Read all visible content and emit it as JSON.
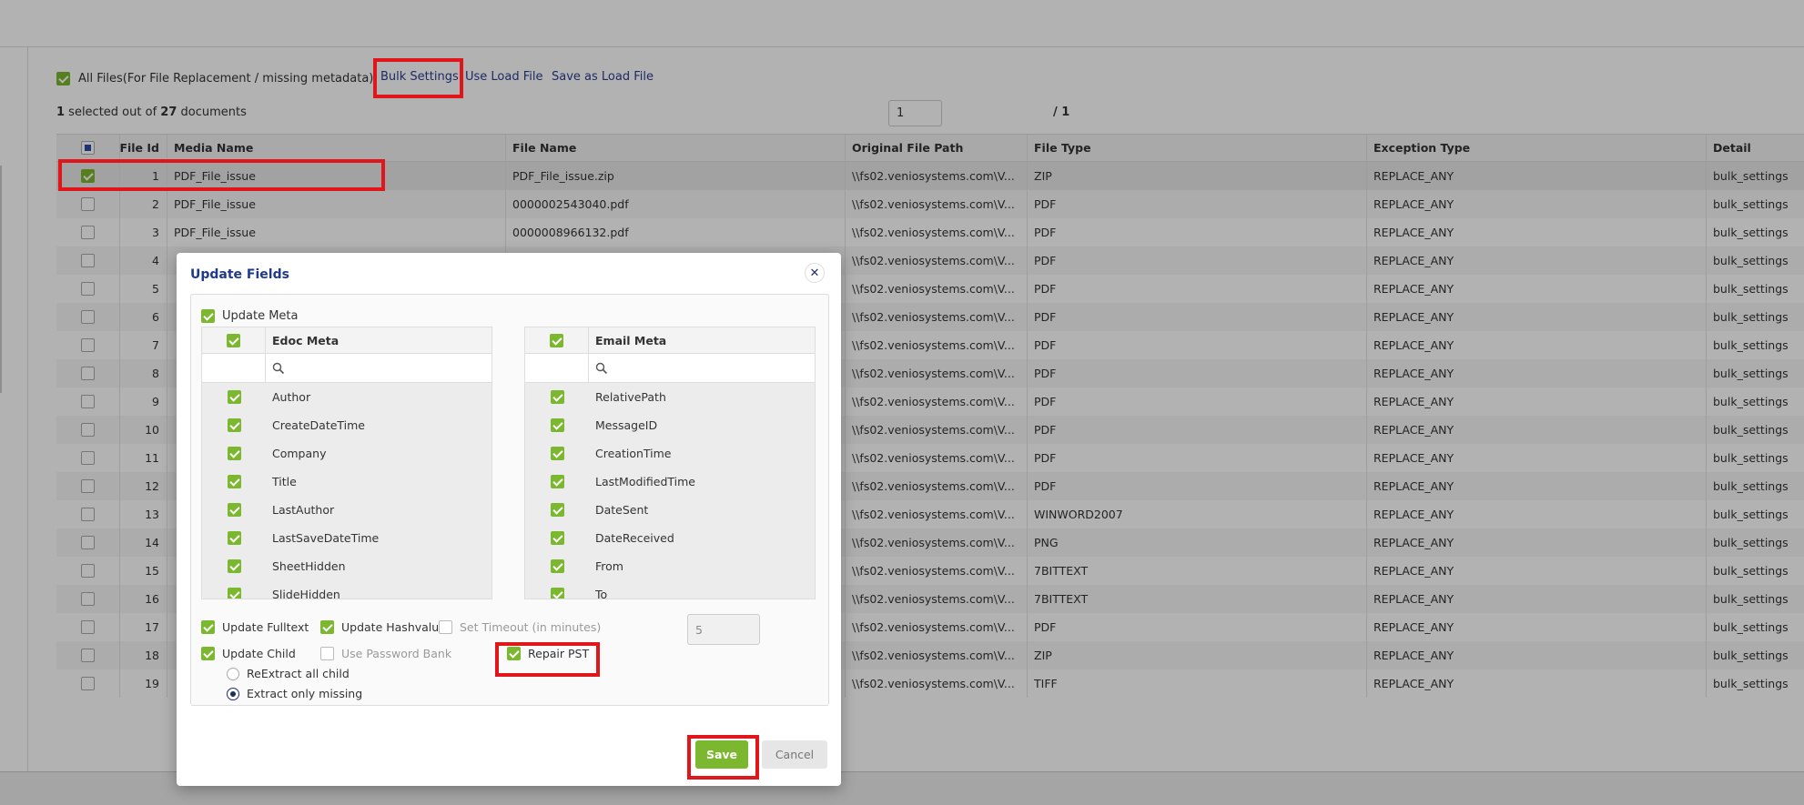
{
  "toolbar": {
    "all_files_label": "All Files(For File Replacement / missing metadata)",
    "bulk_settings": "Bulk Settings",
    "use_load_file": "Use Load File",
    "save_as_load_file": "Save as Load File"
  },
  "selection": {
    "selected": "1",
    "mid": " selected out of ",
    "total": "27",
    "suffix": " documents"
  },
  "pager": {
    "current": "1",
    "total_label": "/ 1"
  },
  "grid": {
    "columns": [
      "File Id",
      "Media Name",
      "File Name",
      "Original File Path",
      "File Type",
      "Exception Type",
      "Detail"
    ],
    "rows": [
      {
        "id": "1",
        "media": "PDF_File_issue",
        "file": "PDF_File_issue.zip",
        "path": "\\\\fs02.veniosystems.com\\V...",
        "type": "ZIP",
        "exc": "REPLACE_ANY",
        "detail": "bulk_settings",
        "checked": true
      },
      {
        "id": "2",
        "media": "PDF_File_issue",
        "file": "0000002543040.pdf",
        "path": "\\\\fs02.veniosystems.com\\V...",
        "type": "PDF",
        "exc": "REPLACE_ANY",
        "detail": "bulk_settings",
        "checked": false
      },
      {
        "id": "3",
        "media": "PDF_File_issue",
        "file": "0000008966132.pdf",
        "path": "\\\\fs02.veniosystems.com\\V...",
        "type": "PDF",
        "exc": "REPLACE_ANY",
        "detail": "bulk_settings",
        "checked": false
      },
      {
        "id": "4",
        "media": "",
        "file": "",
        "path": "\\\\fs02.veniosystems.com\\V...",
        "type": "PDF",
        "exc": "REPLACE_ANY",
        "detail": "bulk_settings",
        "checked": false
      },
      {
        "id": "5",
        "media": "",
        "file": "",
        "path": "\\\\fs02.veniosystems.com\\V...",
        "type": "PDF",
        "exc": "REPLACE_ANY",
        "detail": "bulk_settings",
        "checked": false
      },
      {
        "id": "6",
        "media": "",
        "file": "",
        "path": "\\\\fs02.veniosystems.com\\V...",
        "type": "PDF",
        "exc": "REPLACE_ANY",
        "detail": "bulk_settings",
        "checked": false
      },
      {
        "id": "7",
        "media": "",
        "file": "",
        "path": "\\\\fs02.veniosystems.com\\V...",
        "type": "PDF",
        "exc": "REPLACE_ANY",
        "detail": "bulk_settings",
        "checked": false
      },
      {
        "id": "8",
        "media": "",
        "file": "",
        "path": "\\\\fs02.veniosystems.com\\V...",
        "type": "PDF",
        "exc": "REPLACE_ANY",
        "detail": "bulk_settings",
        "checked": false
      },
      {
        "id": "9",
        "media": "",
        "file": "",
        "path": "\\\\fs02.veniosystems.com\\V...",
        "type": "PDF",
        "exc": "REPLACE_ANY",
        "detail": "bulk_settings",
        "checked": false
      },
      {
        "id": "10",
        "media": "",
        "file": "",
        "path": "\\\\fs02.veniosystems.com\\V...",
        "type": "PDF",
        "exc": "REPLACE_ANY",
        "detail": "bulk_settings",
        "checked": false
      },
      {
        "id": "11",
        "media": "",
        "file": "",
        "path": "\\\\fs02.veniosystems.com\\V...",
        "type": "PDF",
        "exc": "REPLACE_ANY",
        "detail": "bulk_settings",
        "checked": false
      },
      {
        "id": "12",
        "media": "",
        "file": "",
        "path": "\\\\fs02.veniosystems.com\\V...",
        "type": "PDF",
        "exc": "REPLACE_ANY",
        "detail": "bulk_settings",
        "checked": false
      },
      {
        "id": "13",
        "media": "",
        "file": "",
        "path": "\\\\fs02.veniosystems.com\\V...",
        "type": "WINWORD2007",
        "exc": "REPLACE_ANY",
        "detail": "bulk_settings",
        "checked": false
      },
      {
        "id": "14",
        "media": "",
        "file": "",
        "path": "\\\\fs02.veniosystems.com\\V...",
        "type": "PNG",
        "exc": "REPLACE_ANY",
        "detail": "bulk_settings",
        "checked": false
      },
      {
        "id": "15",
        "media": "",
        "file": "",
        "path": "\\\\fs02.veniosystems.com\\V...",
        "type": "7BITTEXT",
        "exc": "REPLACE_ANY",
        "detail": "bulk_settings",
        "checked": false
      },
      {
        "id": "16",
        "media": "",
        "file": "",
        "path": "\\\\fs02.veniosystems.com\\V...",
        "type": "7BITTEXT",
        "exc": "REPLACE_ANY",
        "detail": "bulk_settings",
        "checked": false
      },
      {
        "id": "17",
        "media": "",
        "file": "",
        "path": "\\\\fs02.veniosystems.com\\V...",
        "type": "PDF",
        "exc": "REPLACE_ANY",
        "detail": "bulk_settings",
        "checked": false
      },
      {
        "id": "18",
        "media": "",
        "file": "",
        "path": "\\\\fs02.veniosystems.com\\V...",
        "type": "ZIP",
        "exc": "REPLACE_ANY",
        "detail": "bulk_settings",
        "checked": false
      },
      {
        "id": "19",
        "media": "",
        "file": "",
        "path": "\\\\fs02.veniosystems.com\\V...",
        "type": "TIFF",
        "exc": "REPLACE_ANY",
        "detail": "bulk_settings",
        "checked": false
      }
    ]
  },
  "modal": {
    "title": "Update Fields",
    "update_meta": "Update Meta",
    "edoc": {
      "header": "Edoc Meta",
      "items": [
        "Author",
        "CreateDateTime",
        "Company",
        "Title",
        "LastAuthor",
        "LastSaveDateTime",
        "SheetHidden",
        "SlideHidden"
      ]
    },
    "email": {
      "header": "Email Meta",
      "items": [
        "RelativePath",
        "MessageID",
        "CreationTime",
        "LastModifiedTime",
        "DateSent",
        "DateReceived",
        "From",
        "To"
      ]
    },
    "options": {
      "update_fulltext": "Update Fulltext",
      "update_hashvalue": "Update Hashvalue",
      "set_timeout": "Set Timeout (in minutes)",
      "timeout_value": "5",
      "update_child": "Update Child",
      "use_password_bank": "Use Password Bank",
      "repair_pst": "Repair PST",
      "reextract_all": "ReExtract all child",
      "extract_missing": "Extract only missing"
    },
    "save": "Save",
    "cancel": "Cancel"
  },
  "colors": {
    "accent_green": "#7cb82f",
    "link_blue": "#2b3d8f",
    "highlight_red": "#e0161b"
  }
}
